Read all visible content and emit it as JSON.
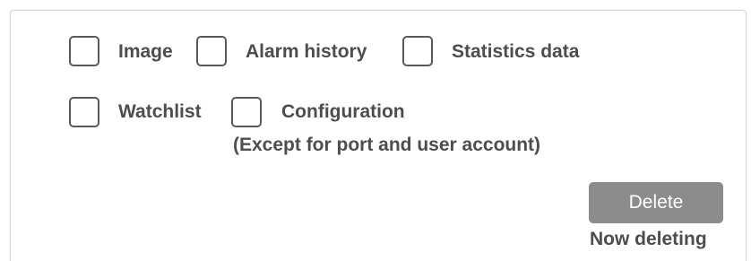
{
  "options": {
    "image": {
      "label": "Image",
      "checked": false
    },
    "alarm_history": {
      "label": "Alarm history",
      "checked": false
    },
    "statistics_data": {
      "label": "Statistics data",
      "checked": false
    },
    "watchlist": {
      "label": "Watchlist",
      "checked": false
    },
    "configuration": {
      "label": "Configuration",
      "note": "(Except for port and user account)",
      "checked": false
    }
  },
  "actions": {
    "delete_label": "Delete",
    "status_text": "Now deleting"
  },
  "colors": {
    "button_bg": "#8c8c8c",
    "checkbox_border": "#595959",
    "text": "#4d4d4d"
  }
}
